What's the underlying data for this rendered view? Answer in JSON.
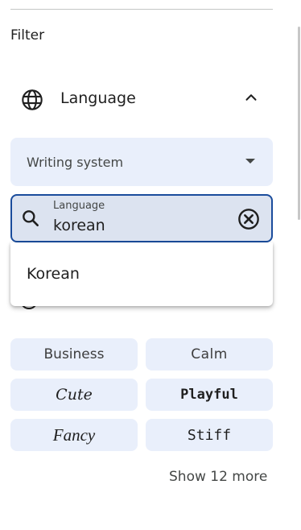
{
  "filter": {
    "title": "Filter"
  },
  "language_section": {
    "label": "Language",
    "expanded": true
  },
  "writing_system": {
    "label": "Writing system"
  },
  "language_field": {
    "label": "Language",
    "value": "korean"
  },
  "suggestions": [
    {
      "label": "Korean"
    }
  ],
  "chips": {
    "business": "Business",
    "calm": "Calm",
    "cute": "Cute",
    "playful": "Playful",
    "fancy": "Fancy",
    "stiff": "Stiff"
  },
  "show_more": {
    "label": "Show 12 more"
  },
  "colors": {
    "chip_bg": "#e9effb",
    "field_focus_border": "#1a4c9c",
    "field_bg": "#dce3f0",
    "text": "#1f1f1f",
    "muted_text": "#444746"
  },
  "icons": [
    "globe-icon",
    "chevron-up-icon",
    "dropdown-arrow-icon",
    "search-icon",
    "clear-icon"
  ]
}
